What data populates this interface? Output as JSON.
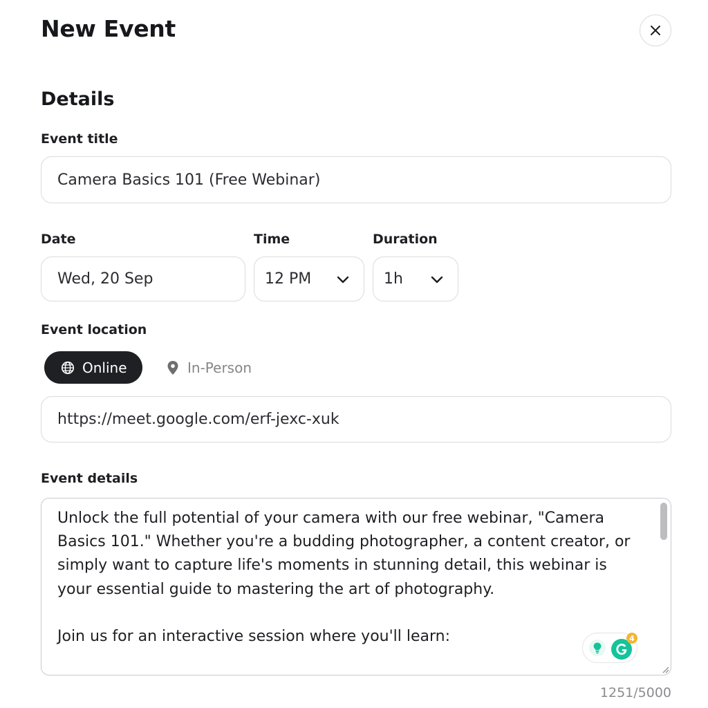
{
  "header": {
    "title": "New Event",
    "close_icon": "close-icon"
  },
  "details": {
    "section_title": "Details",
    "event_title": {
      "label": "Event title",
      "value": "Camera Basics 101 (Free Webinar)"
    },
    "date": {
      "label": "Date",
      "value": "Wed, 20 Sep"
    },
    "time": {
      "label": "Time",
      "value": "12 PM",
      "icon": "chevron-down-icon"
    },
    "duration": {
      "label": "Duration",
      "value": "1h",
      "icon": "chevron-down-icon"
    },
    "location": {
      "label": "Event location",
      "options": [
        {
          "label": "Online",
          "icon": "globe-icon",
          "selected": true
        },
        {
          "label": "In-Person",
          "icon": "map-pin-icon",
          "selected": false
        }
      ],
      "url": "https://meet.google.com/erf-jexc-xuk"
    },
    "event_details": {
      "label": "Event details",
      "text": "Unlock the full potential of your camera with our free webinar, \"Camera Basics 101.\" Whether you're a budding photographer, a content creator, or simply want to capture life's moments in stunning detail, this webinar is your essential guide to mastering the art of photography.\n\nJoin us for an interactive session where you'll learn:",
      "char_count": "1251/5000"
    },
    "grammarly": {
      "badge_count": "4"
    }
  },
  "colors": {
    "toggle_active_bg": "#1e2023",
    "border": "#dadbdf",
    "muted_text": "#858688",
    "grammarly_green": "#15c39a",
    "grammarly_badge": "#f2b632"
  }
}
